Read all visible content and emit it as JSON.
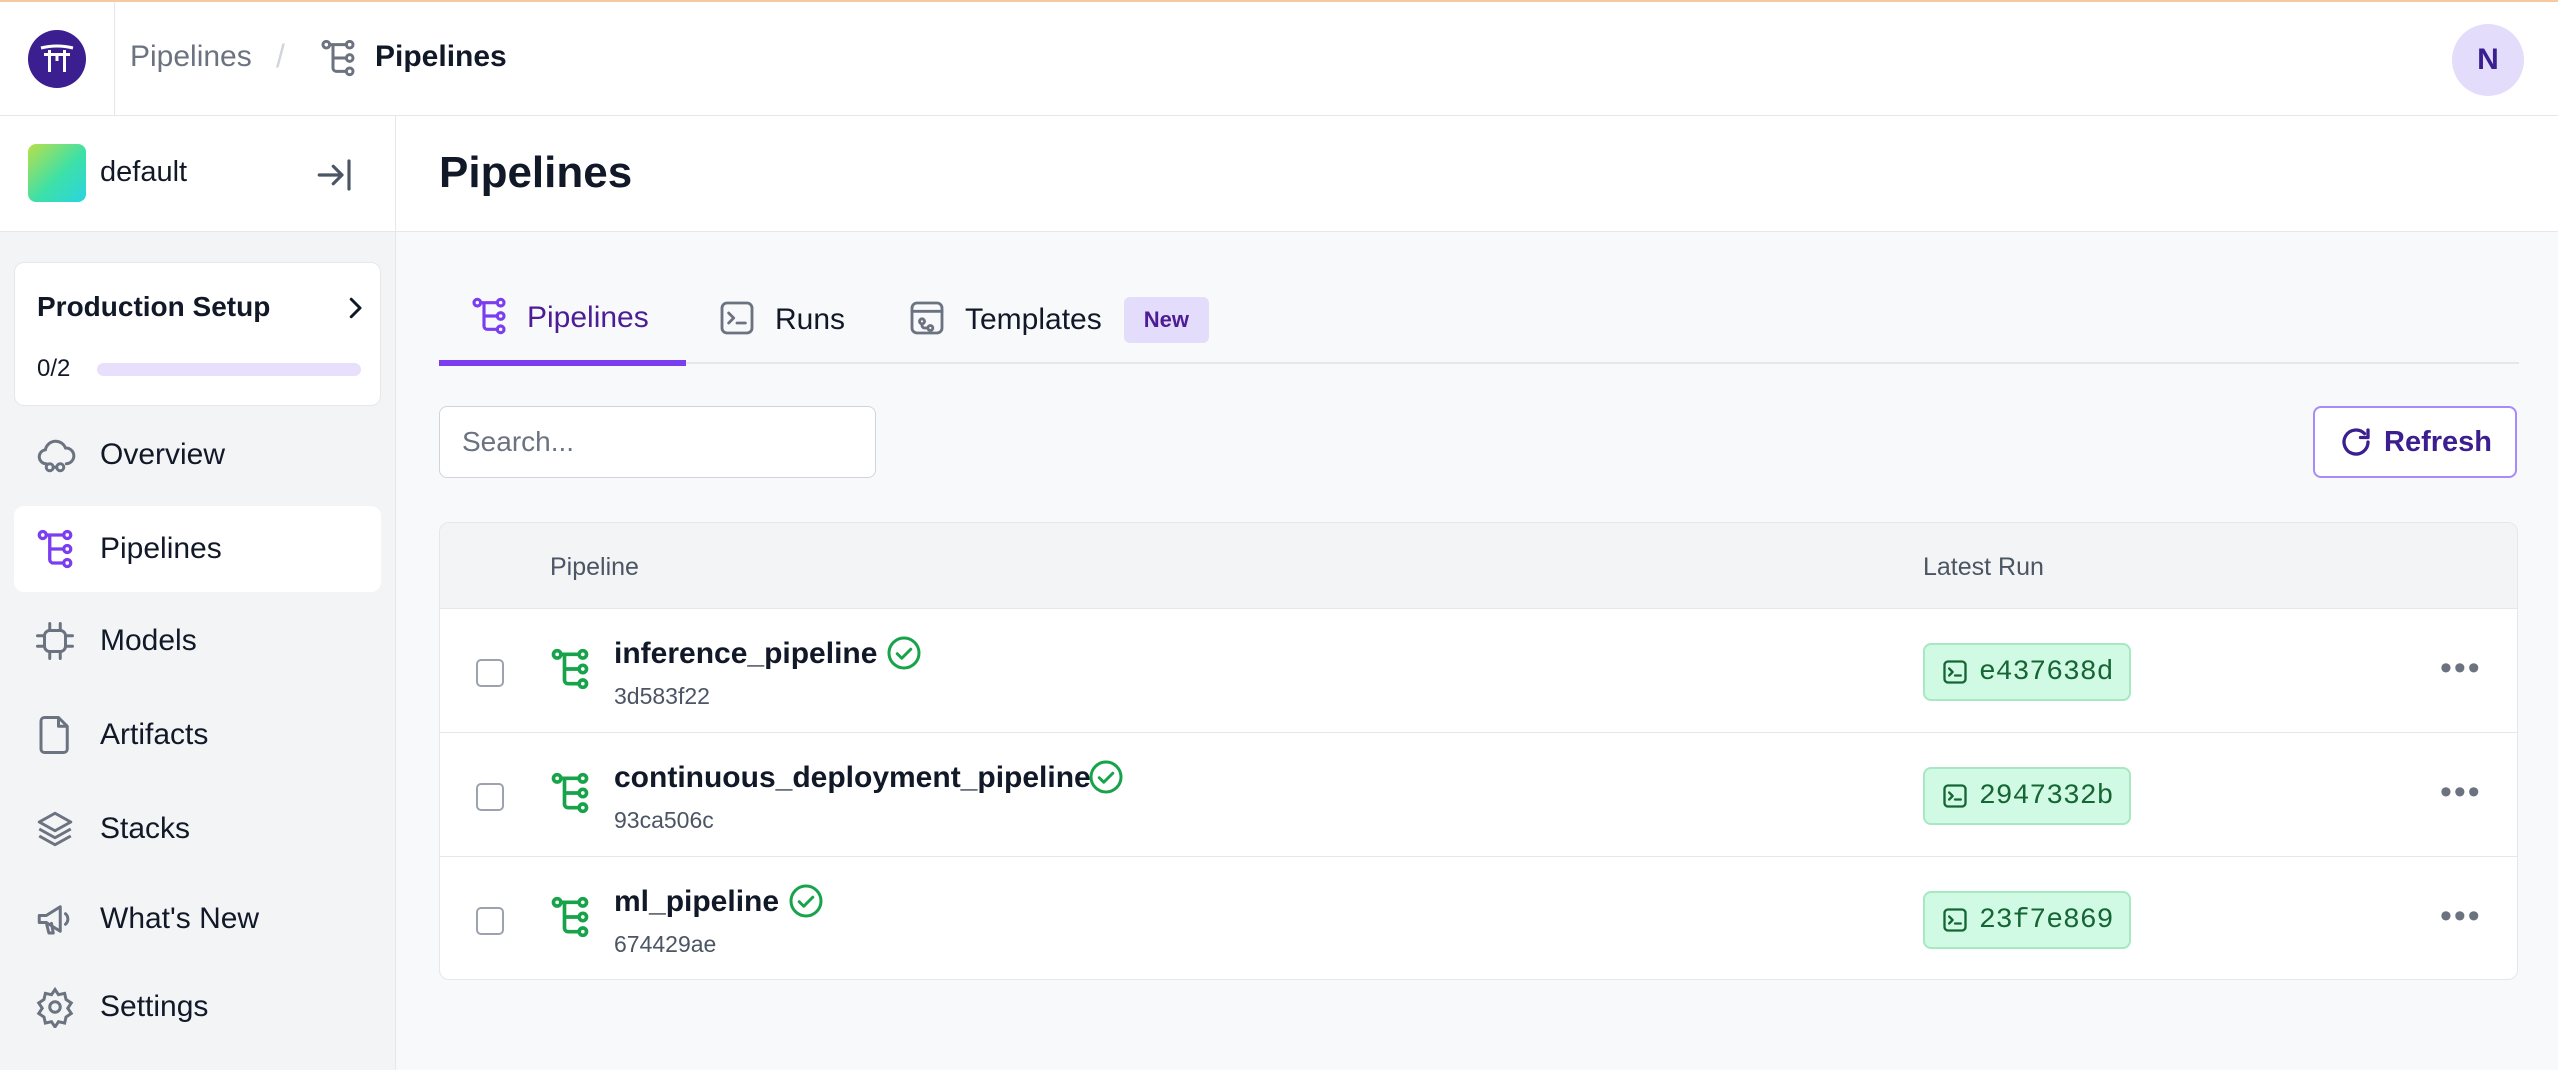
{
  "topbar": {
    "breadcrumb_root": "Pipelines",
    "breadcrumb_separator": "/",
    "breadcrumb_current": "Pipelines",
    "avatar_initial": "N"
  },
  "sidebar": {
    "workspace_name": "default",
    "setup": {
      "title": "Production Setup",
      "progress": "0/2",
      "progress_fraction": 0.0
    },
    "items": [
      {
        "label": "Overview",
        "icon": "cloud-icon",
        "active": false
      },
      {
        "label": "Pipelines",
        "icon": "pipeline-icon",
        "active": true
      },
      {
        "label": "Models",
        "icon": "chip-icon",
        "active": false
      },
      {
        "label": "Artifacts",
        "icon": "file-icon",
        "active": false
      },
      {
        "label": "Stacks",
        "icon": "layers-icon",
        "active": false
      },
      {
        "label": "What's New",
        "icon": "megaphone-icon",
        "active": false
      },
      {
        "label": "Settings",
        "icon": "gear-icon",
        "active": false
      }
    ]
  },
  "main": {
    "title": "Pipelines",
    "tabs": [
      {
        "label": "Pipelines",
        "active": true
      },
      {
        "label": "Runs",
        "active": false
      },
      {
        "label": "Templates",
        "active": false,
        "badge": "New"
      }
    ],
    "search_placeholder": "Search...",
    "refresh_label": "Refresh",
    "table": {
      "columns": [
        "Pipeline",
        "Latest Run"
      ],
      "rows": [
        {
          "name": "inference_pipeline",
          "id": "3d583f22",
          "status": "success",
          "latest_run": "e437638d"
        },
        {
          "name": "continuous_deployment_pipeline",
          "id": "93ca506c",
          "status": "success",
          "latest_run": "2947332b"
        },
        {
          "name": "ml_pipeline",
          "id": "674429ae",
          "status": "success",
          "latest_run": "23f7e869"
        }
      ]
    }
  },
  "colors": {
    "brand": "#3b1e8f",
    "accent": "#7a3ef0",
    "success": "#16a34a",
    "success_bg": "#d1fae5"
  }
}
